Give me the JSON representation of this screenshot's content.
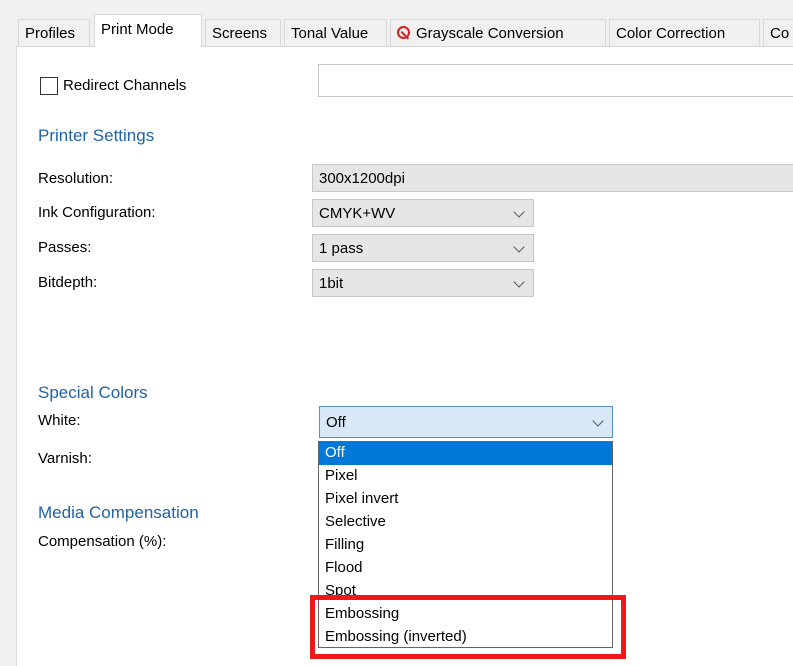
{
  "tabs": [
    {
      "label": "Profiles"
    },
    {
      "label": "Print Mode"
    },
    {
      "label": "Screens"
    },
    {
      "label": "Tonal Value"
    },
    {
      "label": "Grayscale Conversion",
      "icon": "forbidden-icon"
    },
    {
      "label": "Color Correction"
    },
    {
      "label": "Co"
    }
  ],
  "redirect": {
    "label": "Redirect Channels",
    "checked": false,
    "value": ""
  },
  "printer": {
    "heading": "Printer Settings",
    "resolution_label": "Resolution:",
    "resolution_value": "300x1200dpi",
    "ink_label": "Ink Configuration:",
    "ink_value": "CMYK+WV",
    "passes_label": "Passes:",
    "passes_value": "1 pass",
    "bitdepth_label": "Bitdepth:",
    "bitdepth_value": "1bit"
  },
  "special": {
    "heading": "Special Colors",
    "white_label": "White:",
    "white_value": "Off",
    "varnish_label": "Varnish:"
  },
  "media": {
    "heading": "Media Compensation",
    "compensation_label": "Compensation (%):"
  },
  "white_options": [
    {
      "label": "Off",
      "selected": true
    },
    {
      "label": "Pixel"
    },
    {
      "label": "Pixel invert"
    },
    {
      "label": "Selective"
    },
    {
      "label": "Filling"
    },
    {
      "label": "Flood"
    },
    {
      "label": "Spot"
    },
    {
      "label": "Embossing"
    },
    {
      "label": "Embossing (inverted)"
    }
  ],
  "colors": {
    "accent": "#2163a5",
    "selection": "#0078d7",
    "highlight": "#f01818"
  }
}
